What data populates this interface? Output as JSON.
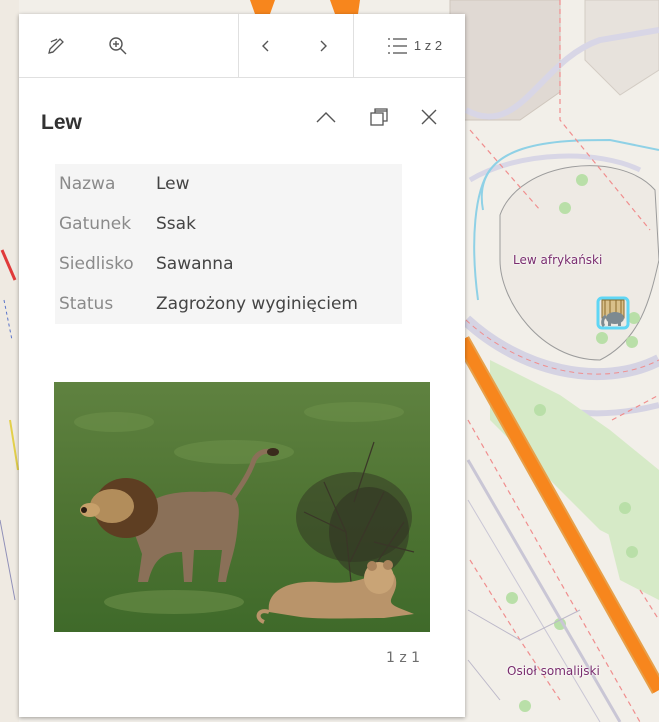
{
  "map": {
    "labels": [
      "Lew afrykański",
      "Osioł somalijski"
    ],
    "colors": {
      "road_major": "#f28b22",
      "background": "#f2efe9",
      "footway": "#f08e8e",
      "park": "#d6eac7"
    }
  },
  "popup": {
    "toolbar": {
      "icons": [
        "pencil-icon",
        "zoom-to-icon",
        "chevron-left-icon",
        "chevron-right-icon",
        "list-icon"
      ],
      "pager": "1 z 2"
    },
    "title": "Lew",
    "header_icons": [
      "chevron-up-icon",
      "dock-icon",
      "close-icon"
    ],
    "attributes": [
      {
        "key": "Nazwa",
        "value": "Lew"
      },
      {
        "key": "Gatunek",
        "value": "Ssak"
      },
      {
        "key": "Siedlisko",
        "value": "Sawanna"
      },
      {
        "key": "Status",
        "value": "Zagrożony wyginięciem"
      }
    ],
    "media_count": "1 z 1"
  }
}
